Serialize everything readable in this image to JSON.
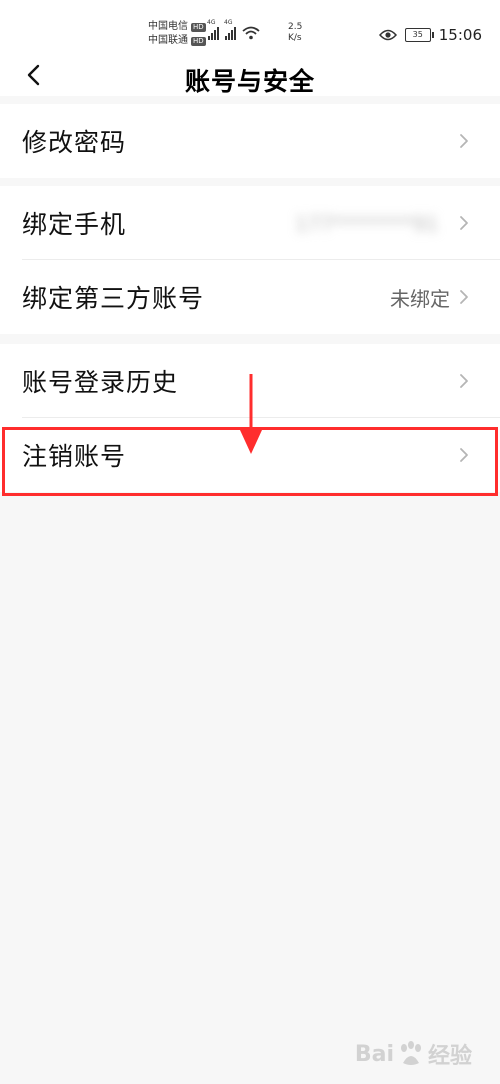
{
  "status_bar": {
    "carrier_1": "中国电信",
    "carrier_2": "中国联通",
    "hd_1": "HD",
    "hd_2": "HD",
    "network_1": "4G",
    "network_2": "4G",
    "speed_value": "2.5",
    "speed_unit": "K/s",
    "battery": "35",
    "time": "15:06"
  },
  "nav": {
    "title": "账号与安全"
  },
  "sections": [
    {
      "items": [
        {
          "label": "修改密码",
          "value": ""
        }
      ]
    },
    {
      "items": [
        {
          "label": "绑定手机",
          "value": "177********91"
        },
        {
          "label": "绑定第三方账号",
          "value": "未绑定"
        }
      ]
    },
    {
      "items": [
        {
          "label": "账号登录历史",
          "value": ""
        },
        {
          "label": "注销账号",
          "value": ""
        }
      ]
    }
  ],
  "annotation": {
    "color": "#ff2d2d",
    "highlighted_item": "注销账号"
  },
  "watermark": {
    "text_left": "Bai",
    "text_right": "经验"
  }
}
